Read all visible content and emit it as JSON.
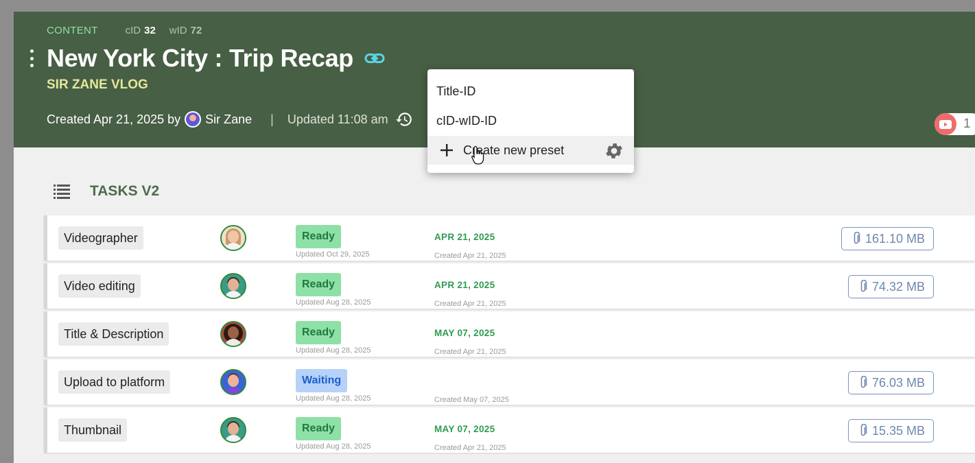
{
  "header": {
    "section_label": "CONTENT",
    "cid_label": "cID",
    "cid_value": "32",
    "wid_label": "wID",
    "wid_value": "72",
    "title": "New York City : Trip Recap",
    "channel": "SIR ZANE VLOG",
    "created_text": "Created Apr 21, 2025 by",
    "creator_name": "Sir Zane",
    "separator": "|",
    "updated_text": "Updated 11:08 am",
    "platform_icon": "youtube-icon",
    "platform_count": "1"
  },
  "dropdown": {
    "items": [
      {
        "label": "Title-ID"
      },
      {
        "label": "cID-wID-ID"
      },
      {
        "label": "Create new preset",
        "icon": "plus-icon",
        "trailing_icon": "gear-icon"
      }
    ]
  },
  "tasks": {
    "title": "TASKS V2",
    "rows": [
      {
        "name": "Videographer",
        "avatar": "woman-avatar",
        "status": "Ready",
        "status_updated": "Updated Oct 29, 2025",
        "due": "APR 21, 2025",
        "created": "Created Apr 21, 2025",
        "attachment": "161.10 MB"
      },
      {
        "name": "Video editing",
        "avatar": "man-avatar",
        "status": "Ready",
        "status_updated": "Updated Aug 28, 2025",
        "due": "APR 21, 2025",
        "created": "Created Apr 21, 2025",
        "attachment": "74.32 MB"
      },
      {
        "name": "Title & Description",
        "avatar": "woman-avatar",
        "status": "Ready",
        "status_updated": "Updated Aug 28, 2025",
        "due": "MAY 07, 2025",
        "created": "Created Apr 21, 2025",
        "attachment": ""
      },
      {
        "name": "Upload to platform",
        "avatar": "group-avatar",
        "status": "Waiting",
        "status_updated": "Updated Aug 28, 2025",
        "due": "",
        "created": "Created May 07, 2025",
        "attachment": "76.03 MB"
      },
      {
        "name": "Thumbnail",
        "avatar": "man-avatar",
        "status": "Ready",
        "status_updated": "Updated Aug 28, 2025",
        "due": "MAY 07, 2025",
        "created": "Created Apr 21, 2025",
        "attachment": "15.35 MB"
      }
    ]
  },
  "colors": {
    "header_bg": "#475f44",
    "ready_bg": "#8ee0a6",
    "waiting_bg": "#b6d2f8",
    "due_text": "#2f9a52",
    "attachment_border": "#7a93b8"
  }
}
